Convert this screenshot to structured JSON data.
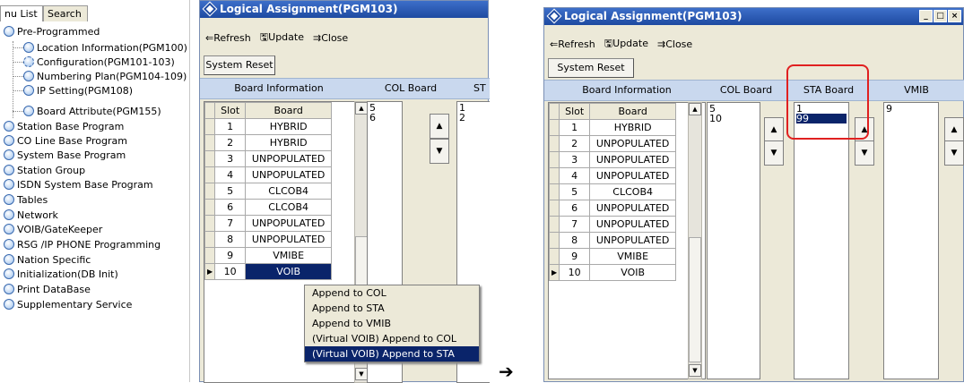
{
  "tree": {
    "tabs": [
      "nu List",
      "Search"
    ],
    "items": [
      "Pre-Programmed",
      "Location Information(PGM100)",
      "Configuration(PGM101-103)",
      "Numbering Plan(PGM104-109)",
      "IP Setting(PGM108)",
      "Board Attribute(PGM155)",
      "Station Base Program",
      "CO Line Base Program",
      "System Base Program",
      "Station Group",
      "ISDN System Base Program",
      "Tables",
      "Network",
      "VOIB/GateKeeper",
      "RSG /IP PHONE Programming",
      "Nation Specific",
      "Initialization(DB Init)",
      "Print DataBase",
      "Supplementary Service"
    ]
  },
  "window_left": {
    "title": "Logical Assignment(PGM103)",
    "toolbar": {
      "refresh": "Refresh",
      "update": "Update",
      "close": "Close"
    },
    "system_reset": "System Reset",
    "headers": {
      "board_info": "Board Information",
      "col_board": "COL Board",
      "sta_board": "ST"
    },
    "columns": {
      "slot": "Slot",
      "board": "Board"
    },
    "rows": [
      [
        "1",
        "HYBRID"
      ],
      [
        "2",
        "HYBRID"
      ],
      [
        "3",
        "UNPOPULATED"
      ],
      [
        "4",
        "UNPOPULATED"
      ],
      [
        "5",
        "CLCOB4"
      ],
      [
        "6",
        "CLCOB4"
      ],
      [
        "7",
        "UNPOPULATED"
      ],
      [
        "8",
        "UNPOPULATED"
      ],
      [
        "9",
        "VMIBE"
      ],
      [
        "10",
        "VOIB"
      ]
    ],
    "col_list": [
      "5",
      "6"
    ],
    "sta_list": [
      "1",
      "2"
    ],
    "context_menu": [
      "Append to COL",
      "Append to STA",
      "Append to VMIB",
      "(Virtual VOIB) Append to COL",
      "(Virtual VOIB) Append to STA"
    ]
  },
  "arrow": "➔",
  "window_right": {
    "title": "Logical Assignment(PGM103)",
    "toolbar": {
      "refresh": "Refresh",
      "update": "Update",
      "close": "Close"
    },
    "system_reset": "System Reset",
    "headers": {
      "board_info": "Board Information",
      "col_board": "COL Board",
      "sta_board": "STA Board",
      "vmib": "VMIB"
    },
    "columns": {
      "slot": "Slot",
      "board": "Board"
    },
    "rows": [
      [
        "1",
        "HYBRID"
      ],
      [
        "2",
        "UNPOPULATED"
      ],
      [
        "3",
        "UNPOPULATED"
      ],
      [
        "4",
        "UNPOPULATED"
      ],
      [
        "5",
        "CLCOB4"
      ],
      [
        "6",
        "UNPOPULATED"
      ],
      [
        "7",
        "UNPOPULATED"
      ],
      [
        "8",
        "UNPOPULATED"
      ],
      [
        "9",
        "VMIBE"
      ],
      [
        "10",
        "VOIB"
      ]
    ],
    "col_list": [
      "5",
      "10"
    ],
    "sta_list": [
      "1",
      "99"
    ],
    "vmib_list": [
      "9"
    ],
    "highlight_color": "#e02020"
  }
}
